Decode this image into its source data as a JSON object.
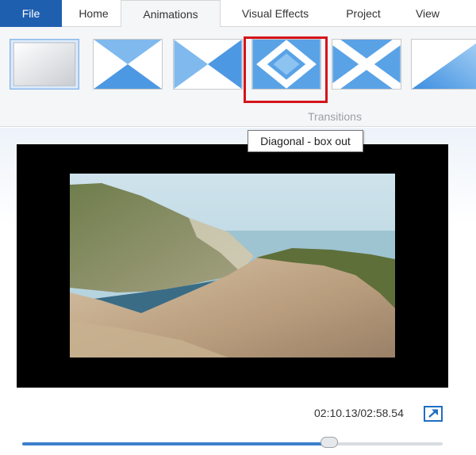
{
  "tabs": {
    "file": "File",
    "home": "Home",
    "animations": "Animations",
    "visual_effects": "Visual Effects",
    "project": "Project",
    "view": "View"
  },
  "ribbon": {
    "group_label": "Transitions",
    "transitions": [
      {
        "icon": "no-transition-icon",
        "selected": true
      },
      {
        "icon": "bow-tie-vertical-icon",
        "selected": false
      },
      {
        "icon": "bow-tie-horizontal-icon",
        "selected": false
      },
      {
        "icon": "diagonal-box-out-icon",
        "selected": false,
        "highlighted": true
      },
      {
        "icon": "diagonal-cross-out-icon",
        "selected": false
      },
      {
        "icon": "diagonal-down-right-icon",
        "selected": false
      }
    ]
  },
  "tooltip": {
    "text": "Diagonal - box out"
  },
  "player": {
    "timecode": "02:10.13/02:58.54",
    "progress": 0.73
  },
  "colors": {
    "file_tab": "#1f5fb0",
    "highlight": "#d4141c",
    "accent": "#3d7fcc"
  }
}
